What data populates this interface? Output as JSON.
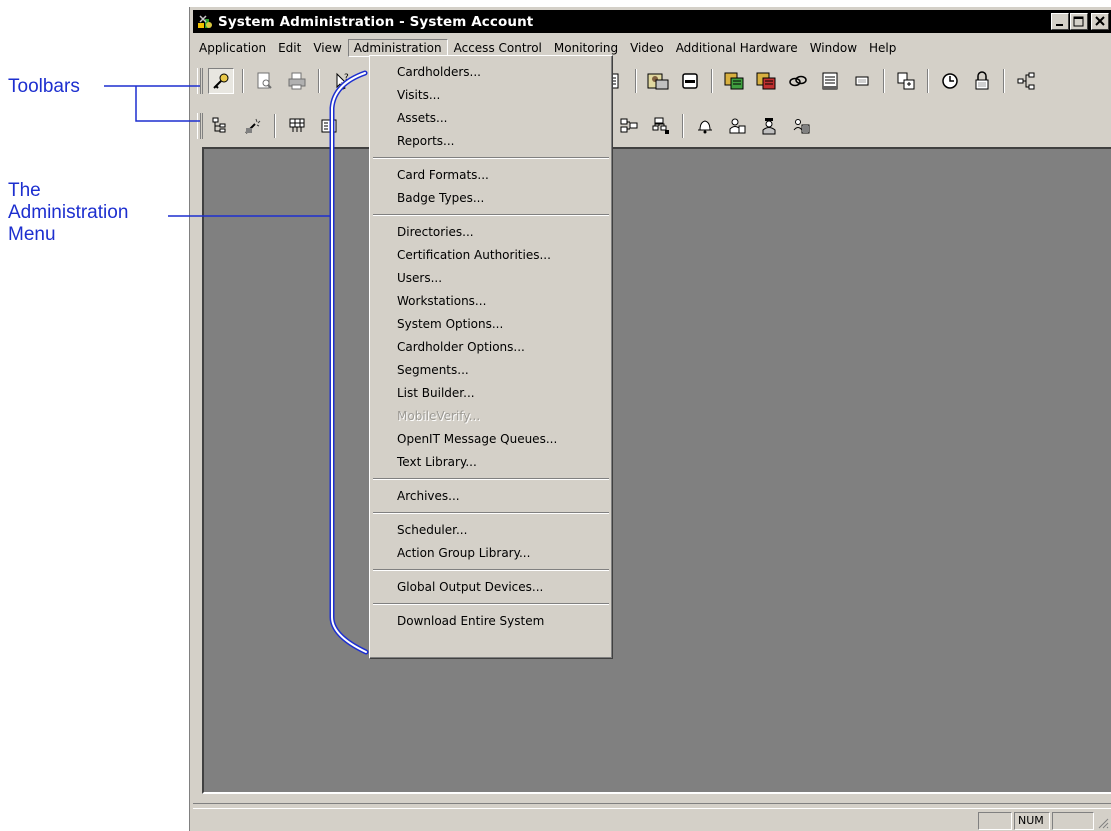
{
  "callouts": {
    "toolbars": "Toolbars",
    "admin_menu_line1": "The",
    "admin_menu_line2": "Administration",
    "admin_menu_line3": "Menu"
  },
  "window": {
    "title": "System Administration - System Account",
    "controls": [
      "minimize",
      "maximize",
      "close"
    ]
  },
  "menubar": {
    "items": [
      "Application",
      "Edit",
      "View",
      "Administration",
      "Access Control",
      "Monitoring",
      "Video",
      "Additional Hardware",
      "Window",
      "Help"
    ],
    "active": "Administration"
  },
  "toolbar1_icons": [
    "key-icon",
    "print-preview-icon",
    "printer-icon",
    "help-pointer-icon",
    "document-icon",
    "cardholder-badge-icon",
    "reader-icon",
    "panel-icon",
    "panel-alt-icon",
    "link-icon",
    "list-icon",
    "box-icon",
    "download-icon",
    "clock-icon",
    "lock-icon",
    "network-icon"
  ],
  "toolbar2_icons": [
    "tree-icon",
    "wand-icon",
    "grid-icon",
    "module-icon",
    "group-icon",
    "group-plus-icon",
    "bell-icon",
    "people-icon",
    "guard-icon",
    "person-group-icon"
  ],
  "administration_menu": {
    "groups": [
      [
        "Cardholders...",
        "Visits...",
        "Assets...",
        "Reports..."
      ],
      [
        "Card Formats...",
        "Badge Types..."
      ],
      [
        "Directories...",
        "Certification Authorities...",
        "Users...",
        "Workstations...",
        "System Options...",
        "Cardholder Options...",
        "Segments...",
        "List Builder...",
        "MobileVerify...",
        "OpenIT Message Queues...",
        "Text Library..."
      ],
      [
        "Archives..."
      ],
      [
        "Scheduler...",
        "Action Group Library..."
      ],
      [
        "Global Output Devices..."
      ],
      [
        "Download Entire System"
      ]
    ],
    "disabled": [
      "MobileVerify..."
    ]
  },
  "statusbar": {
    "panes": [
      "",
      "NUM",
      ""
    ]
  },
  "colors": {
    "callout": "#1d2fcf",
    "face": "#d4d0c8",
    "workspace": "#808080",
    "titlebar": "#000000"
  }
}
